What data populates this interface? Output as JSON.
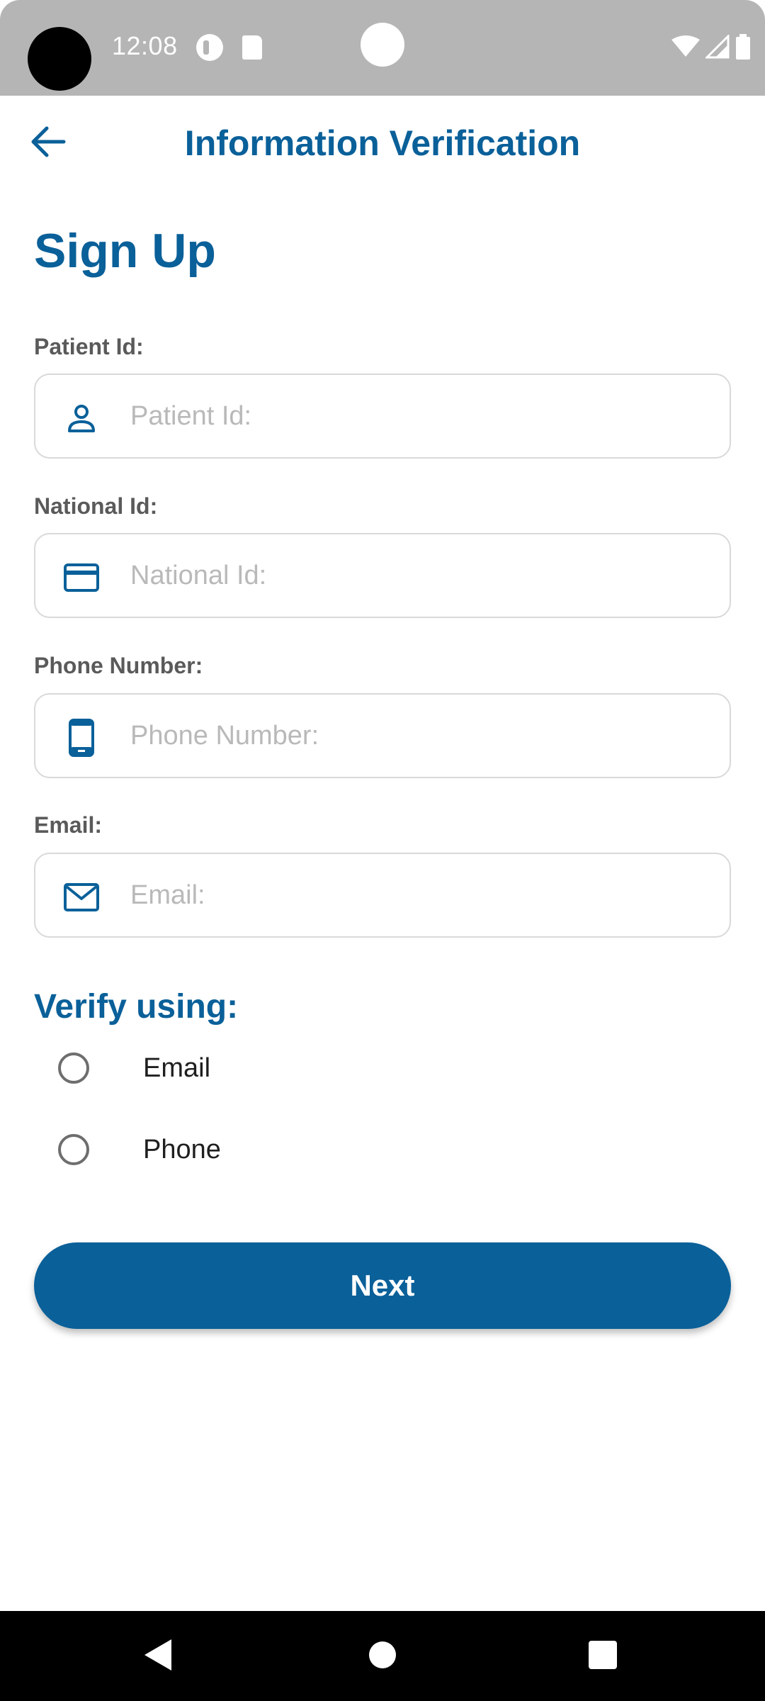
{
  "status_bar": {
    "time": "12:08"
  },
  "app_bar": {
    "title": "Information Verification"
  },
  "page": {
    "title": "Sign Up"
  },
  "fields": [
    {
      "label": "Patient Id:",
      "placeholder": "Patient Id:",
      "icon": "person-icon"
    },
    {
      "label": "National Id:",
      "placeholder": "National Id:",
      "icon": "credit-card-icon"
    },
    {
      "label": "Phone Number:",
      "placeholder": "Phone Number:",
      "icon": "smartphone-icon"
    },
    {
      "label": "Email:",
      "placeholder": "Email:",
      "icon": "mail-icon"
    }
  ],
  "verify": {
    "title": "Verify using:",
    "options": [
      {
        "label": "Email",
        "selected": false
      },
      {
        "label": "Phone",
        "selected": false
      }
    ]
  },
  "next_button": {
    "label": "Next"
  },
  "colors": {
    "accent": "#0a6099",
    "label": "#5a5a5a",
    "placeholder": "#b9b9b9",
    "border": "#d9d9d9"
  }
}
